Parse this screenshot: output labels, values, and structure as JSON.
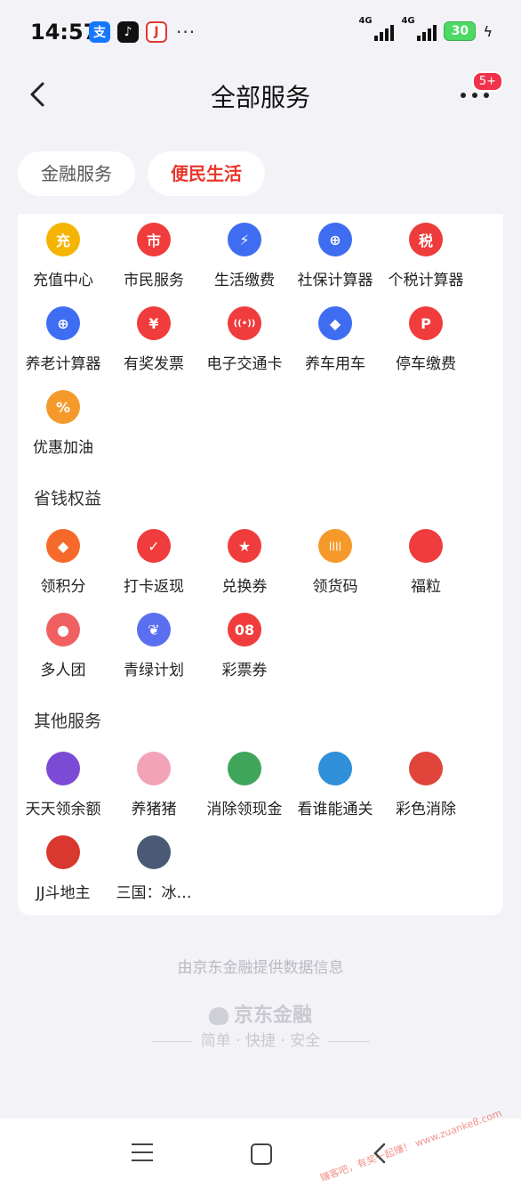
{
  "status": {
    "time": "14:57",
    "battery": "30",
    "net1": "4G",
    "net2": "4G"
  },
  "header": {
    "title": "全部服务",
    "badge": "5+"
  },
  "tabs": [
    {
      "label": "金融服务"
    },
    {
      "label": "便民生活"
    }
  ],
  "grid1": [
    {
      "label": "充值中心",
      "icon": "topup-icon",
      "glyph": "充",
      "color": "#f5b400"
    },
    {
      "label": "市民服务",
      "icon": "citizen-icon",
      "glyph": "市",
      "color": "#f03c3c"
    },
    {
      "label": "生活缴费",
      "icon": "utility-icon",
      "glyph": "⚡",
      "color": "#3f6df2"
    },
    {
      "label": "社保计算器",
      "icon": "social-security-icon",
      "glyph": "⊕",
      "color": "#3f6df2"
    },
    {
      "label": "个税计算器",
      "icon": "tax-icon",
      "glyph": "税",
      "color": "#ee3b3b"
    },
    {
      "label": "养老计算器",
      "icon": "pension-icon",
      "glyph": "⊕",
      "color": "#3f6df2"
    },
    {
      "label": "有奖发票",
      "icon": "invoice-icon",
      "glyph": "¥",
      "color": "#f03c3c"
    },
    {
      "label": "电子交通卡",
      "icon": "transit-card-icon",
      "glyph": "((•))",
      "color": "#f03c3c"
    },
    {
      "label": "养车用车",
      "icon": "car-icon",
      "glyph": "◆",
      "color": "#3f6df2"
    },
    {
      "label": "停车缴费",
      "icon": "parking-icon",
      "glyph": "P",
      "color": "#f03c3c"
    },
    {
      "label": "优惠加油",
      "icon": "fuel-icon",
      "glyph": "%",
      "color": "#f59a2a"
    }
  ],
  "section2": {
    "title": "省钱权益"
  },
  "grid2": [
    {
      "label": "领积分",
      "icon": "points-icon",
      "glyph": "◆",
      "color": "#f56a2a"
    },
    {
      "label": "打卡返现",
      "icon": "calendar-icon",
      "glyph": "✓",
      "color": "#f03c3c"
    },
    {
      "label": "兑换券",
      "icon": "voucher-icon",
      "glyph": "★",
      "color": "#f03c3c"
    },
    {
      "label": "领货码",
      "icon": "code-icon",
      "glyph": "||||",
      "color": "#f59a2a"
    },
    {
      "label": "福粒",
      "icon": "bead-icon",
      "glyph": "",
      "color": "#f03c3c"
    },
    {
      "label": "多人团",
      "icon": "group-icon",
      "glyph": "●",
      "color": "#f06060"
    },
    {
      "label": "青绿计划",
      "icon": "leaf-icon",
      "glyph": "❦",
      "color": "#5a6ff0"
    },
    {
      "label": "彩票券",
      "icon": "lottery-icon",
      "glyph": "08",
      "color": "#f03c3c"
    }
  ],
  "section3": {
    "title": "其他服务"
  },
  "grid3": [
    {
      "label": "天天领余额",
      "icon": "balance-game-icon",
      "glyph": "",
      "color": "#7b4bd6"
    },
    {
      "label": "养猪猪",
      "icon": "pig-game-icon",
      "glyph": "",
      "color": "#f3a3b8"
    },
    {
      "label": "消除领现金",
      "icon": "mahjong-game-icon",
      "glyph": "",
      "color": "#3fa55b"
    },
    {
      "label": "看谁能通关",
      "icon": "match-game-icon",
      "glyph": "",
      "color": "#2f8fd8"
    },
    {
      "label": "彩色消除",
      "icon": "color-game-icon",
      "glyph": "",
      "color": "#e0443a"
    },
    {
      "label": "JJ斗地主",
      "icon": "landlord-game-icon",
      "glyph": "",
      "color": "#d8382e"
    },
    {
      "label": "三国：冰…",
      "icon": "three-kingdoms-icon",
      "glyph": "",
      "color": "#4a5a74"
    }
  ],
  "footer": {
    "provider": "由京东金融提供数据信息",
    "brand": "京东金融",
    "slogan": "简单 · 快捷 · 安全"
  },
  "watermark": "赚客吧，有奖一起赚！ www.zuanke8.com"
}
